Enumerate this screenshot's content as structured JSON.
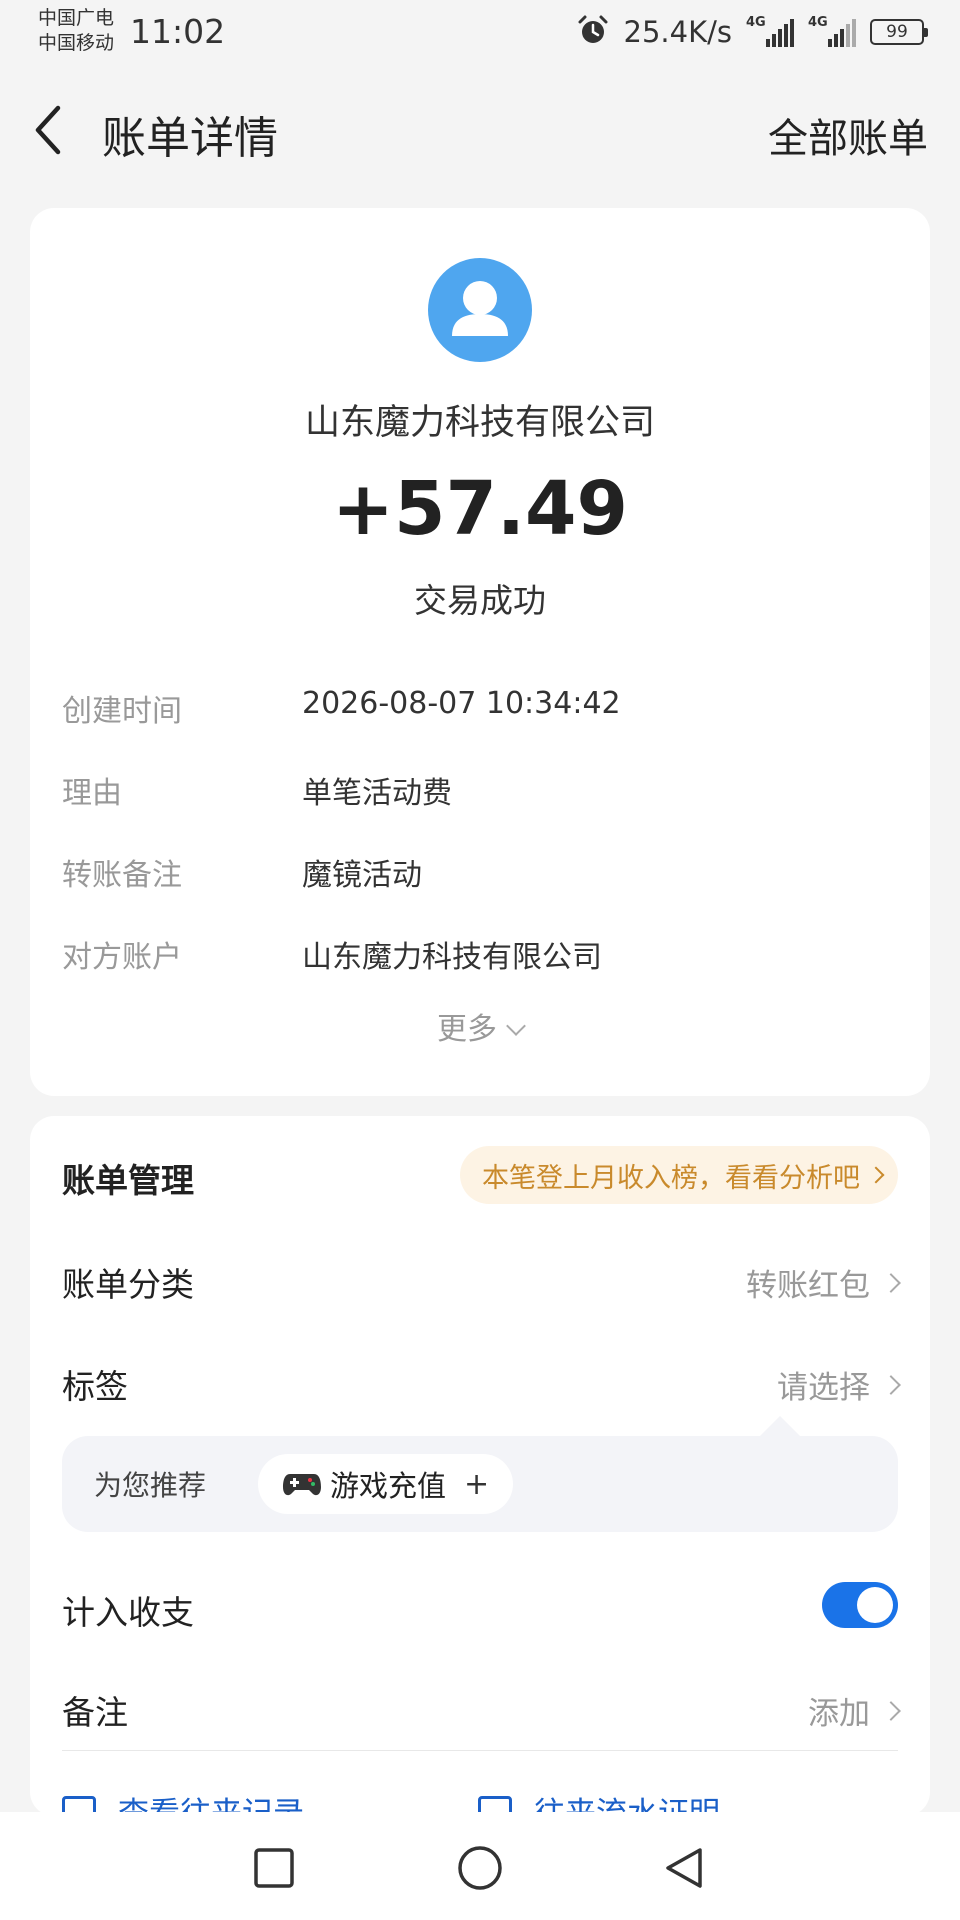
{
  "status_bar": {
    "carrier_1": "中国广电",
    "carrier_2": "中国移动",
    "time": "11:02",
    "net_speed": "25.4K/s",
    "network_1": "4G",
    "network_2": "4G",
    "battery": "99"
  },
  "header": {
    "title": "账单详情",
    "all_bills": "全部账单"
  },
  "summary": {
    "payee": "山东魔力科技有限公司",
    "amount": "+57.49",
    "status": "交易成功",
    "avatar_color": "#4fa6ef"
  },
  "details": [
    {
      "key": "创建时间",
      "value": "2026-08-07 10:34:42"
    },
    {
      "key": "理由",
      "value": "单笔活动费"
    },
    {
      "key": "转账备注",
      "value": "魔镜活动"
    },
    {
      "key": "对方账户",
      "value": "山东魔力科技有限公司"
    }
  ],
  "more_label": "更多",
  "management": {
    "title": "账单管理",
    "promo": "本笔登上月收入榜，看看分析吧",
    "category_label": "账单分类",
    "category_value": "转账红包",
    "tag_label": "标签",
    "tag_value": "请选择",
    "recommend_label": "为您推荐",
    "recommend_chip": "游戏充值",
    "recommend_chip_add": "+",
    "include_label": "计入收支",
    "include_enabled": true,
    "note_label": "备注",
    "note_value": "添加",
    "link_1": "查看往来记录",
    "link_2": "往来流水证明"
  },
  "colors": {
    "accent": "#1a73e8",
    "promo_text": "#c98a2c",
    "promo_bg": "#fdf3e4"
  }
}
